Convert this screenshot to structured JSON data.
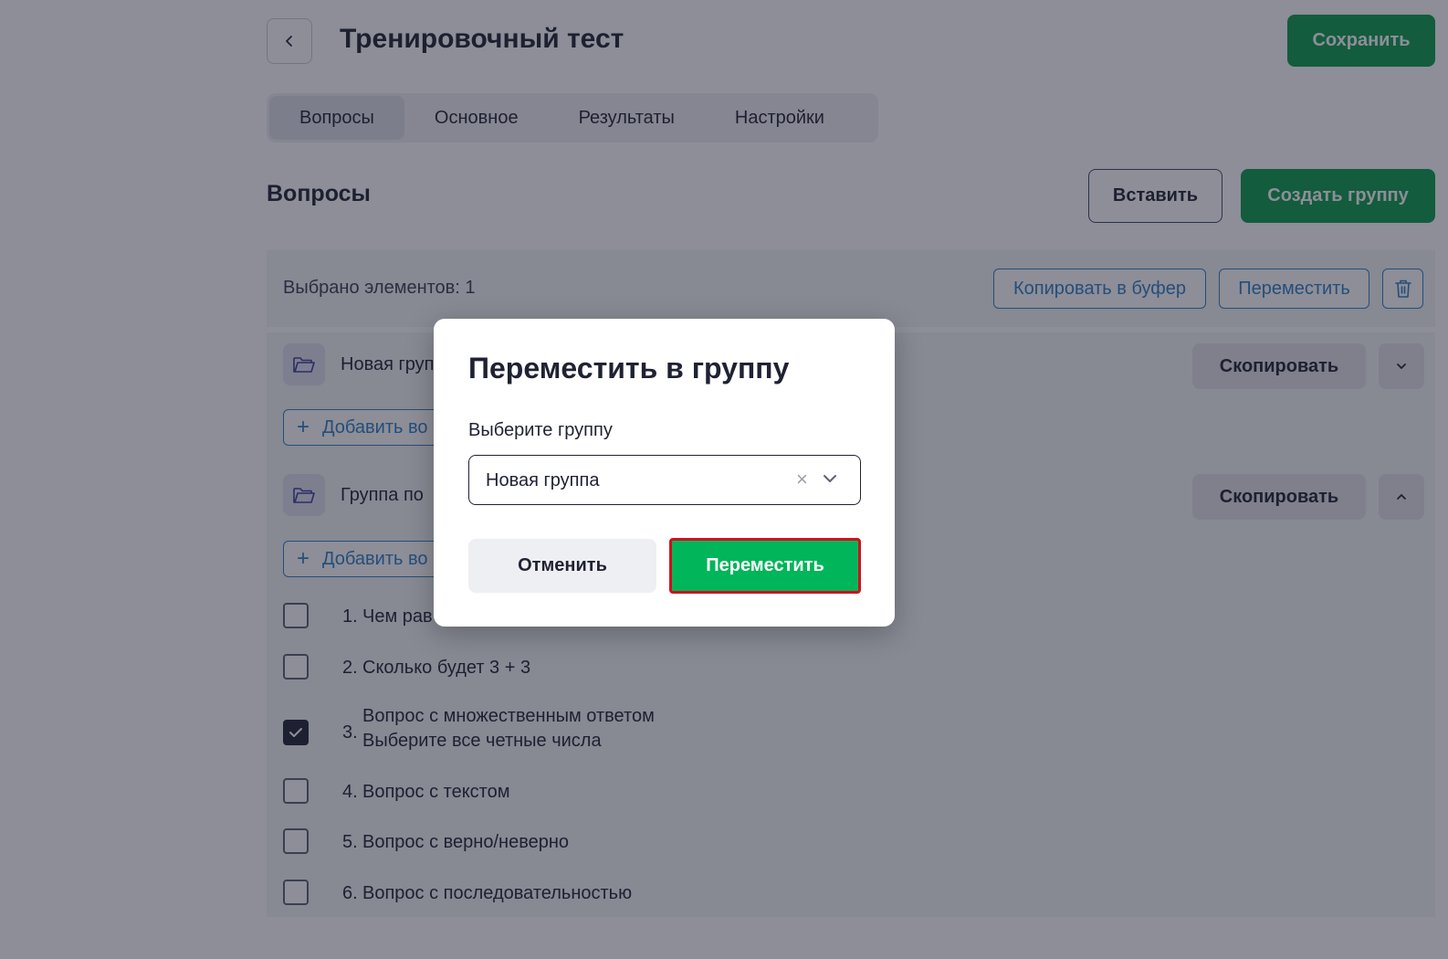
{
  "header": {
    "title": "Тренировочный тест",
    "save_label": "Сохранить"
  },
  "tabs": [
    {
      "label": "Вопросы",
      "active": true
    },
    {
      "label": "Основное",
      "active": false
    },
    {
      "label": "Результаты",
      "active": false
    },
    {
      "label": "Настройки",
      "active": false
    }
  ],
  "section": {
    "title": "Вопросы",
    "insert_label": "Вставить",
    "create_group_label": "Создать группу"
  },
  "selection": {
    "count_text": "Выбрано элементов: 1",
    "copy_buffer_label": "Копировать в буфер",
    "move_label": "Переместить"
  },
  "groups": [
    {
      "name": "Новая груп",
      "copy_label": "Скопировать",
      "add_label": "Добавить во"
    },
    {
      "name": "Группа по",
      "copy_label": "Скопировать",
      "add_label": "Добавить во"
    }
  ],
  "questions": [
    {
      "num": "1.",
      "text": "Чем рав",
      "checked": false
    },
    {
      "num": "2.",
      "text": "Сколько будет 3 + 3",
      "checked": false
    },
    {
      "num": "3.",
      "text": "Вопрос с множественным ответом",
      "sub": "Выберите все четные числа",
      "checked": true
    },
    {
      "num": "4.",
      "text": "Вопрос с текстом",
      "checked": false
    },
    {
      "num": "5.",
      "text": "Вопрос с верно/неверно",
      "checked": false
    },
    {
      "num": "6.",
      "text": "Вопрос с последовательностью",
      "checked": false
    }
  ],
  "modal": {
    "title": "Переместить в группу",
    "field_label": "Выберите группу",
    "selected_group": "Новая группа",
    "cancel_label": "Отменить",
    "confirm_label": "Переместить"
  },
  "colors": {
    "primary_green": "#0b9a4c",
    "highlight_green": "#00b55a",
    "highlight_border": "#d0101e",
    "link_blue": "#2d7ec4"
  },
  "icons": {
    "back": "chevron-left-icon",
    "trash": "trash-icon",
    "folder": "folder-icon",
    "chevron_down": "chevron-down-icon",
    "chevron_up": "chevron-up-icon",
    "clear": "close-icon",
    "plus": "plus-icon",
    "check": "check-icon"
  }
}
